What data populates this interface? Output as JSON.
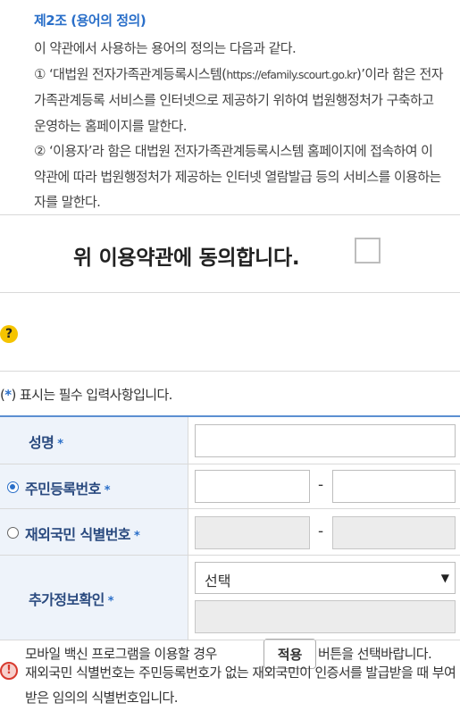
{
  "terms": {
    "article_title": "제2조 (용어의 정의)",
    "intro": "이 약관에서 사용하는 용어의 정의는 다음과 같다.",
    "item1_pre": "① ‘대법원 전자가족관계등록시스템(",
    "item1_url": "https://efamily.scourt.go.kr",
    "item1_post": ")’이라 함은 전자가족관계등록 서비스를 인터넷으로 제공하기 위하여 법원행정처가 구축하고 운영하는 홈페이지를 말한다.",
    "item2": "② ‘이용자’라 함은 대법원 전자가족관계등록시스템 홈페이지에 접속하여 이 약관에 따라 법원행정처가 제공하는 인터넷 열람발급 등의 서비스를 이용하는 자를 말한다."
  },
  "agree": {
    "text": "위 이용약관에 동의합니다.",
    "checked": false
  },
  "vaccine": {
    "icon": "question-icon",
    "text_before": "모바일 백신 프로그램을 이용할 경우",
    "button_label": "적용",
    "text_after": "버튼을 선택바랍니다."
  },
  "required_note": {
    "open": "(",
    "star": "*",
    "rest": ") 표시는 필수 입력사항입니다."
  },
  "form": {
    "required_mark": "*",
    "name_label": "성명",
    "name_value": "",
    "rrn_label": "주민등록번호",
    "rrn_selected": true,
    "rrn_front": "",
    "rrn_back": "",
    "foreign_label": "재외국민 식별번호",
    "foreign_selected": false,
    "foreign_front": "",
    "foreign_back": "",
    "separator": "-",
    "extra_label": "추가정보확인",
    "extra_select_value": "선택",
    "extra_value": ""
  },
  "notice": {
    "icon": "exclamation-icon",
    "text": "재외국민 식별번호는 주민등록번호가 없는 재외국민이 인증서를 발급받을 때 부여받은 임의의 식별번호입니다."
  },
  "colors": {
    "accent": "#2a6fc9",
    "label_bg": "#eef3fa",
    "label_text": "#2a4a7f",
    "warning": "#d83a2e",
    "question": "#f5c400"
  }
}
